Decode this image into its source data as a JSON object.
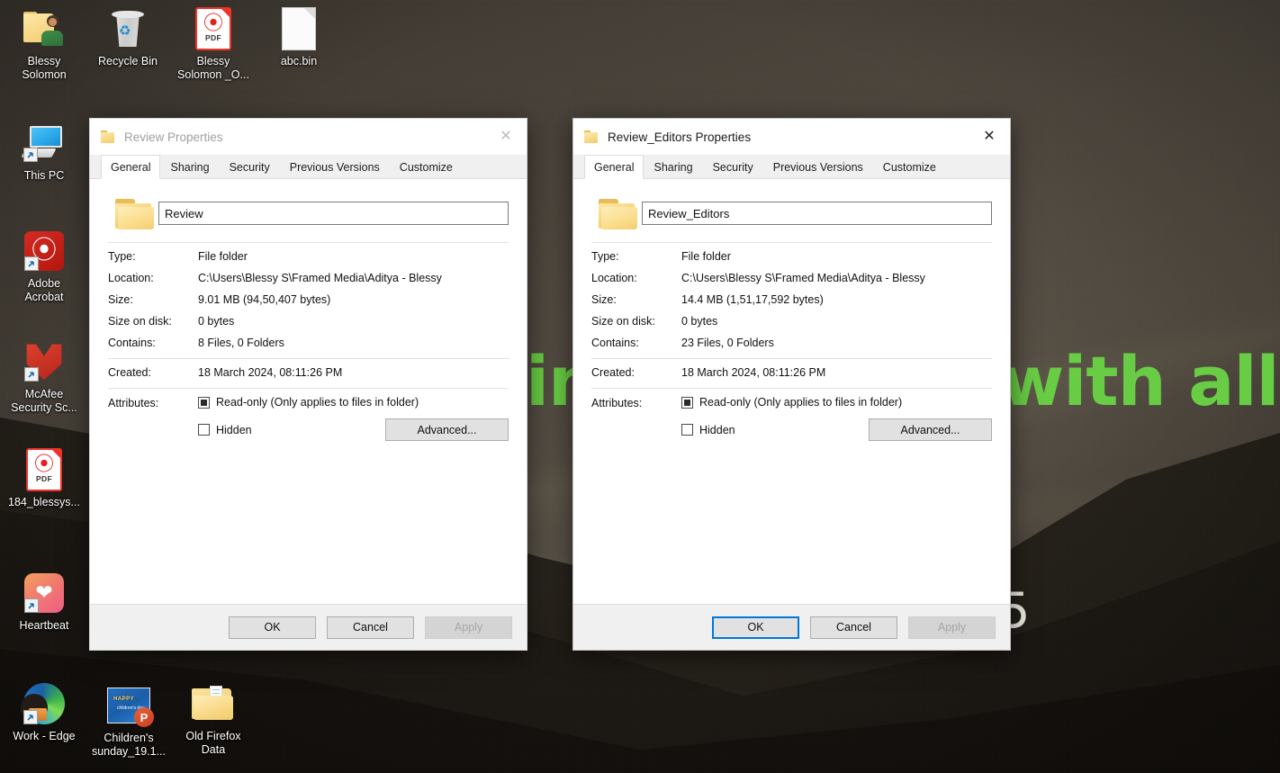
{
  "desktop": {
    "wallpaper_text": {
      "middle": "in",
      "right": "with all",
      "fragment": "5"
    },
    "icons": [
      {
        "name": "Blessy\nSolomon",
        "label_lines": [
          "Blessy",
          "Solomon"
        ],
        "icon": "folder-user-icon",
        "shortcut": false
      },
      {
        "name": "Recycle Bin",
        "label_lines": [
          "Recycle Bin"
        ],
        "icon": "recycle-bin-icon",
        "shortcut": false
      },
      {
        "name": "Blessy Solomon _O...",
        "label_lines": [
          "Blessy",
          "Solomon _O..."
        ],
        "icon": "pdf-file-icon",
        "shortcut": false
      },
      {
        "name": "abc.bin",
        "label_lines": [
          "abc.bin"
        ],
        "icon": "plain-file-icon",
        "shortcut": false
      },
      {
        "name": "This PC",
        "label_lines": [
          "This PC"
        ],
        "icon": "this-pc-icon",
        "shortcut": true
      },
      {
        "name": "Adobe Acrobat",
        "label_lines": [
          "Adobe",
          "Acrobat"
        ],
        "icon": "adobe-acrobat-icon",
        "shortcut": true
      },
      {
        "name": "McAfee Security Sc...",
        "label_lines": [
          "McAfee",
          "Security Sc..."
        ],
        "icon": "mcafee-icon",
        "shortcut": true
      },
      {
        "name": "184_blessys...",
        "label_lines": [
          "184_blessys..."
        ],
        "icon": "pdf-file-icon",
        "shortcut": false
      },
      {
        "name": "Heartbeat",
        "label_lines": [
          "Heartbeat"
        ],
        "icon": "heartbeat-icon",
        "shortcut": true
      },
      {
        "name": "Work - Edge",
        "label_lines": [
          "Work - Edge"
        ],
        "icon": "edge-icon",
        "shortcut": true
      },
      {
        "name": "Children's sunday_19.1...",
        "label_lines": [
          "Children's",
          "sunday_19.1..."
        ],
        "icon": "powerpoint-file-icon",
        "shortcut": false
      },
      {
        "name": "Old Firefox Data",
        "label_lines": [
          "Old Firefox",
          "Data"
        ],
        "icon": "folder-documents-icon",
        "shortcut": false
      }
    ]
  },
  "dialog_left": {
    "title": "Review Properties",
    "close_label": "✕",
    "tabs": [
      {
        "label": "General",
        "selected": true
      },
      {
        "label": "Sharing",
        "selected": false
      },
      {
        "label": "Security",
        "selected": false
      },
      {
        "label": "Previous Versions",
        "selected": false
      },
      {
        "label": "Customize",
        "selected": false
      }
    ],
    "name_value": "Review",
    "rows": [
      {
        "key": "Type:",
        "value": "File folder"
      },
      {
        "key": "Location:",
        "value": "C:\\Users\\Blessy S\\Framed Media\\Aditya - Blessy"
      },
      {
        "key": "Size:",
        "value": "9.01 MB (94,50,407 bytes)"
      },
      {
        "key": "Size on disk:",
        "value": "0 bytes"
      },
      {
        "key": "Contains:",
        "value": "8 Files, 0 Folders"
      }
    ],
    "created": {
      "key": "Created:",
      "value": "18 March 2024, 08:11:26 PM"
    },
    "attributes": {
      "key": "Attributes:",
      "readonly_label": "Read-only (Only applies to files in folder)",
      "readonly_state": "indeterminate",
      "hidden_label": "Hidden",
      "hidden_state": "unchecked",
      "advanced_label": "Advanced..."
    },
    "buttons": {
      "ok": "OK",
      "cancel": "Cancel",
      "apply": "Apply"
    }
  },
  "dialog_right": {
    "title": "Review_Editors Properties",
    "close_label": "✕",
    "tabs": [
      {
        "label": "General",
        "selected": true
      },
      {
        "label": "Sharing",
        "selected": false
      },
      {
        "label": "Security",
        "selected": false
      },
      {
        "label": "Previous Versions",
        "selected": false
      },
      {
        "label": "Customize",
        "selected": false
      }
    ],
    "name_value": "Review_Editors",
    "rows": [
      {
        "key": "Type:",
        "value": "File folder"
      },
      {
        "key": "Location:",
        "value": "C:\\Users\\Blessy S\\Framed Media\\Aditya - Blessy"
      },
      {
        "key": "Size:",
        "value": "14.4 MB (1,51,17,592 bytes)"
      },
      {
        "key": "Size on disk:",
        "value": "0 bytes"
      },
      {
        "key": "Contains:",
        "value": "23 Files, 0 Folders"
      }
    ],
    "created": {
      "key": "Created:",
      "value": "18 March 2024, 08:11:26 PM"
    },
    "attributes": {
      "key": "Attributes:",
      "readonly_label": "Read-only (Only applies to files in folder)",
      "readonly_state": "indeterminate",
      "hidden_label": "Hidden",
      "hidden_state": "unchecked",
      "advanced_label": "Advanced..."
    },
    "buttons": {
      "ok": "OK",
      "cancel": "Cancel",
      "apply": "Apply"
    }
  },
  "colors": {
    "focus_blue": "#0078d7",
    "wallpaper_green": "#68cc44",
    "wallpaper_base": "#4a443c",
    "dialog_face": "#f0f0f0"
  }
}
